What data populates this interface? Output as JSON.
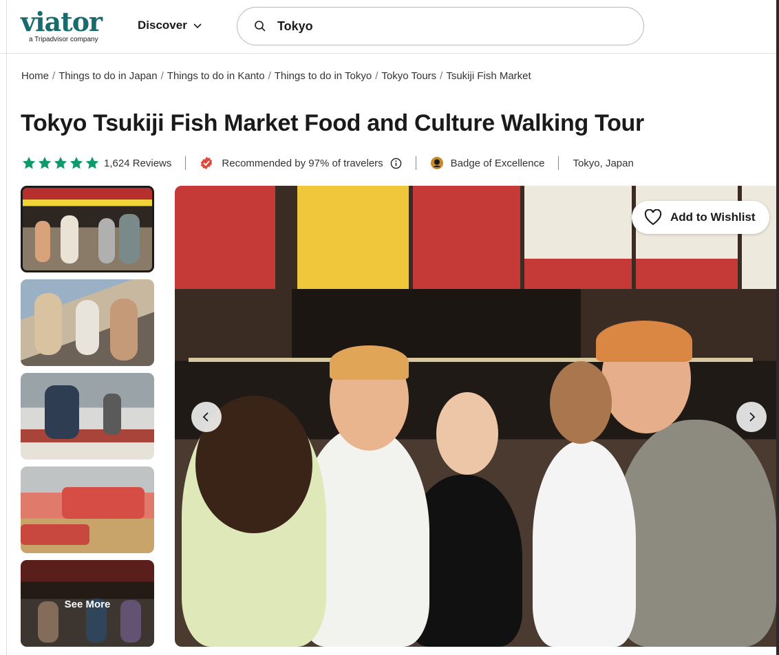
{
  "header": {
    "logo_text": "viator",
    "logo_sub": "a Tripadvisor company",
    "discover_label": "Discover",
    "search_value": "Tokyo",
    "brand_color": "#186b6d"
  },
  "breadcrumb": [
    "Home",
    "Things to do in Japan",
    "Things to do in Kanto",
    "Things to do in Tokyo",
    "Tokyo Tours",
    "Tsukiji Fish Market"
  ],
  "product": {
    "title": "Tokyo Tsukiji Fish Market Food and Culture Walking Tour",
    "rating_stars": 5,
    "reviews": "1,624 Reviews",
    "recommended": "Recommended by 97% of travelers",
    "badge": "Badge of Excellence",
    "location": "Tokyo, Japan",
    "star_color": "#0e9a6b",
    "recommend_color": "#e0493a"
  },
  "gallery": {
    "see_more_label": "See More",
    "wishlist_label": "Add to Wishlist",
    "thumbnail_count": 5
  },
  "icons": {
    "search": "search-icon",
    "chevron": "chevron-down-icon",
    "info": "info-icon",
    "heart": "heart-icon",
    "prev": "chevron-left-icon",
    "next": "chevron-right-icon"
  }
}
